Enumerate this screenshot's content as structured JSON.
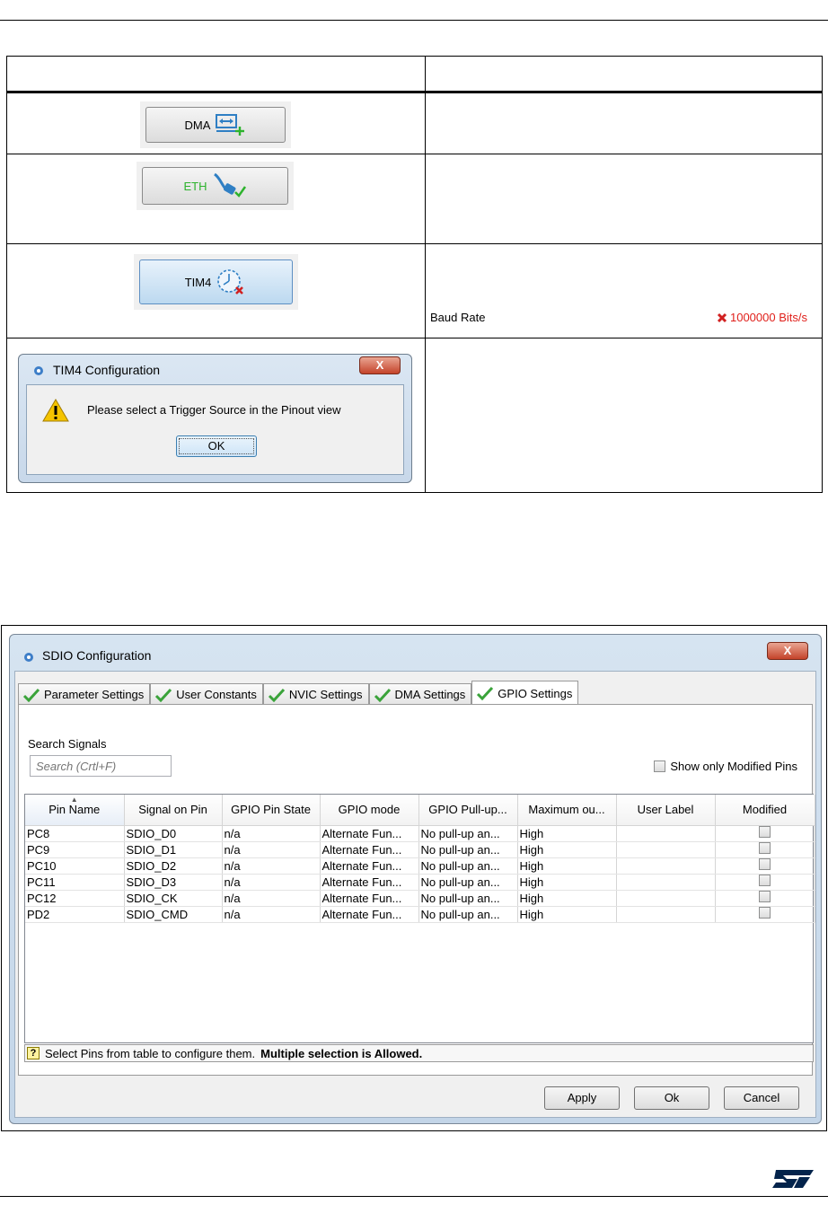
{
  "table_rows": {
    "dma_button_label": "DMA",
    "eth_button_label": "ETH",
    "tim4_button_label": "TIM4",
    "baud": {
      "label": "Baud Rate",
      "value": "1000000 Bits/s"
    },
    "tim4_dialog": {
      "title": "TIM4 Configuration",
      "close": "X",
      "message": "Please select a Trigger Source in the Pinout view",
      "ok": "OK"
    }
  },
  "sdio_dialog": {
    "title": "SDIO Configuration",
    "close": "X",
    "tabs": [
      "Parameter Settings",
      "User Constants",
      "NVIC Settings",
      "DMA Settings",
      "GPIO Settings"
    ],
    "active_tab": "GPIO Settings",
    "search_label": "Search Signals",
    "search_placeholder": "Search (Crtl+F)",
    "show_modified_label": "Show only Modified Pins",
    "columns": [
      "Pin Name",
      "Signal on Pin",
      "GPIO Pin State",
      "GPIO mode",
      "GPIO Pull-up...",
      "Maximum ou...",
      "User Label",
      "Modified"
    ],
    "rows": [
      [
        "PC8",
        "SDIO_D0",
        "n/a",
        "Alternate Fun...",
        "No pull-up an...",
        "High",
        ""
      ],
      [
        "PC9",
        "SDIO_D1",
        "n/a",
        "Alternate Fun...",
        "No pull-up an...",
        "High",
        ""
      ],
      [
        "PC10",
        "SDIO_D2",
        "n/a",
        "Alternate Fun...",
        "No pull-up an...",
        "High",
        ""
      ],
      [
        "PC11",
        "SDIO_D3",
        "n/a",
        "Alternate Fun...",
        "No pull-up an...",
        "High",
        ""
      ],
      [
        "PC12",
        "SDIO_CK",
        "n/a",
        "Alternate Fun...",
        "No pull-up an...",
        "High",
        ""
      ],
      [
        "PD2",
        "SDIO_CMD",
        "n/a",
        "Alternate Fun...",
        "No pull-up an...",
        "High",
        ""
      ]
    ],
    "status_text": "Select Pins from table to configure them.",
    "status_bold": "Multiple selection is Allowed.",
    "status_icon": "?",
    "buttons": {
      "apply": "Apply",
      "ok": "Ok",
      "cancel": "Cancel"
    }
  },
  "colors": {
    "error_red": "#e0201b",
    "ok_green": "#2db32d",
    "st_blue": "#03234b"
  }
}
